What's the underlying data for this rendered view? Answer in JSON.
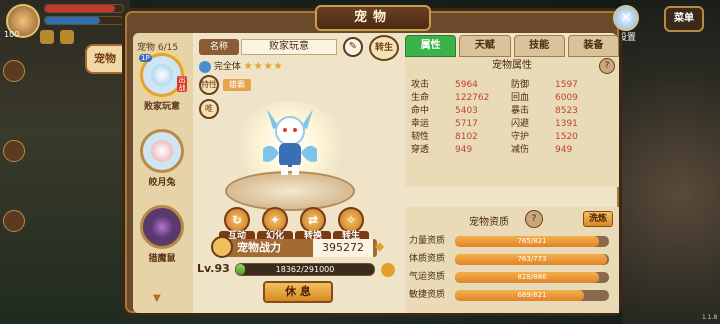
{
  "panel": {
    "title": "宠物"
  },
  "side_tab": {
    "label": "宠物"
  },
  "pet_list": {
    "count_label": "宠物 6/15",
    "pets": [
      {
        "name": "败家玩意",
        "badge": "1P",
        "status": "出战"
      },
      {
        "name": "皎月兔"
      },
      {
        "name": "猎魔鼠"
      }
    ]
  },
  "pet": {
    "name_label": "名称",
    "name": "败家玩意",
    "form": "完全体",
    "stars": "★★★★",
    "trait_label": "特性",
    "trait_value": "雄霸",
    "shape_label": "唯",
    "reborn_label": "转生"
  },
  "actions": {
    "interact": "互动",
    "transform": "幻化",
    "convert": "转换",
    "reborn": "转生"
  },
  "power": {
    "label": "宠物战力",
    "value": "395272"
  },
  "level": {
    "label": "Lv.93",
    "exp": "18362/291000",
    "fraction": 0.063
  },
  "rest_button": "休 息",
  "tabs": [
    "属性",
    "天赋",
    "技能",
    "装备"
  ],
  "attributes": {
    "heading": "宠物属性",
    "rows": [
      {
        "k1": "攻击",
        "v1": "5964",
        "k2": "防御",
        "v2": "1597"
      },
      {
        "k1": "生命",
        "v1": "122762",
        "k2": "回血",
        "v2": "6009"
      },
      {
        "k1": "命中",
        "v1": "5403",
        "k2": "暴击",
        "v2": "8523"
      },
      {
        "k1": "幸运",
        "v1": "5717",
        "k2": "闪避",
        "v2": "1391"
      },
      {
        "k1": "韧性",
        "v1": "8102",
        "k2": "守护",
        "v2": "1520"
      },
      {
        "k1": "穿透",
        "v1": "949",
        "k2": "减伤",
        "v2": "949"
      }
    ]
  },
  "quality": {
    "heading": "宠物资质",
    "wash_button": "洗炼",
    "rows": [
      {
        "label": "力量资质",
        "text": "765/821",
        "fraction": 0.932
      },
      {
        "label": "体质资质",
        "text": "763/773",
        "fraction": 0.987
      },
      {
        "label": "气运资质",
        "text": "828/886",
        "fraction": 0.935
      },
      {
        "label": "敏捷资质",
        "text": "689/821",
        "fraction": 0.839
      }
    ]
  },
  "hud": {
    "settings": "设置",
    "menu": "菜单",
    "level": "100",
    "version": "1.1.8"
  }
}
